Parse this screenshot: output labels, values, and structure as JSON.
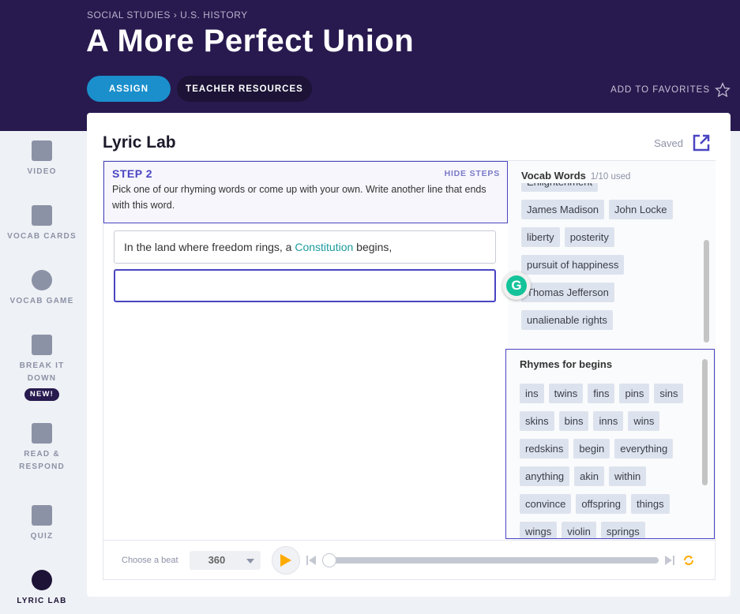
{
  "breadcrumb": {
    "subject": "SOCIAL STUDIES",
    "sep": "›",
    "topic": "U.S. HISTORY"
  },
  "title": "A More Perfect Union",
  "buttons": {
    "assign": "ASSIGN",
    "teacher_resources": "TEACHER RESOURCES",
    "favorites": "ADD TO FAVORITES"
  },
  "sidebar": [
    {
      "label": "VIDEO",
      "icon": "video-icon"
    },
    {
      "label": "VOCAB CARDS",
      "icon": "vocab-cards-icon"
    },
    {
      "label": "VOCAB GAME",
      "icon": "lightning-icon"
    },
    {
      "label": "BREAK IT DOWN",
      "icon": "break-it-down-icon",
      "badge": "NEW!"
    },
    {
      "label": "READ & RESPOND",
      "icon": "book-icon"
    },
    {
      "label": "QUIZ",
      "icon": "quiz-icon"
    },
    {
      "label": "LYRIC LAB",
      "icon": "lyric-lab-icon",
      "active": true
    }
  ],
  "lab": {
    "title": "Lyric Lab",
    "saved": "Saved"
  },
  "step": {
    "title": "STEP 2",
    "hide": "HIDE STEPS",
    "text": "Pick one of our rhyming words or come up with your own. Write another line that ends with this word."
  },
  "lines": {
    "l1_pre": "In the land where freedom rings, a ",
    "l1_word": "Constitution",
    "l1_post": " begins,",
    "l2": ""
  },
  "vocab": {
    "title": "Vocab Words",
    "used": "1/10 used",
    "words": [
      "Enlightenment",
      "James Madison",
      "John Locke",
      "liberty",
      "posterity",
      "pursuit of happiness",
      "Thomas Jefferson",
      "unalienable rights"
    ]
  },
  "rhymes": {
    "prefix": "Rhymes for",
    "word": "begins",
    "words": [
      "ins",
      "twins",
      "fins",
      "pins",
      "sins",
      "skins",
      "bins",
      "inns",
      "wins",
      "redskins",
      "begin",
      "everything",
      "anything",
      "akin",
      "within",
      "convince",
      "offspring",
      "things",
      "wings",
      "violin",
      "springs"
    ]
  },
  "player": {
    "choose": "Choose a beat",
    "beat": "360",
    "progress": 0
  },
  "colors": {
    "header": "#281a4f",
    "accent": "#4a45c2",
    "assign": "#1a8fcc",
    "play": "#ffab00"
  }
}
